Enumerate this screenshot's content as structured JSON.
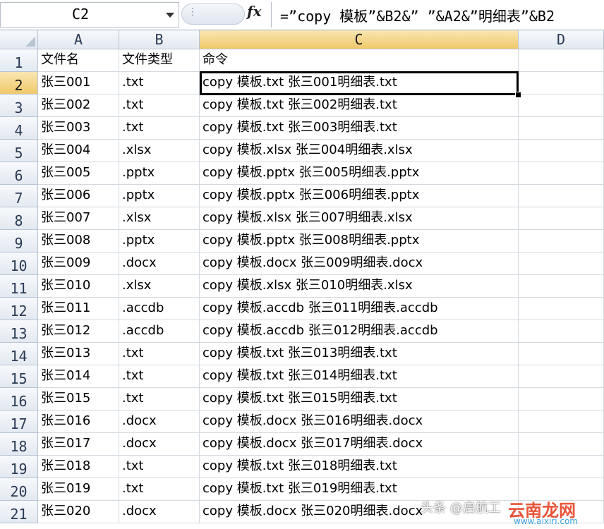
{
  "name_box": {
    "value": "C2"
  },
  "formula_bar": {
    "fx_label": "fx",
    "formula": "=”copy 模板”&B2&” ”&A2&”明细表”&B2"
  },
  "columns": [
    "A",
    "B",
    "C",
    "D"
  ],
  "selected_column": "C",
  "selected_row": 2,
  "rows": [
    {
      "num": "1",
      "a": "文件名",
      "b": "文件类型",
      "c": "命令"
    },
    {
      "num": "2",
      "a": "张三001",
      "b": ".txt",
      "c": "copy 模板.txt 张三001明细表.txt"
    },
    {
      "num": "3",
      "a": "张三002",
      "b": ".txt",
      "c": "copy 模板.txt 张三002明细表.txt"
    },
    {
      "num": "4",
      "a": "张三003",
      "b": ".txt",
      "c": "copy 模板.txt 张三003明细表.txt"
    },
    {
      "num": "5",
      "a": "张三004",
      "b": ".xlsx",
      "c": "copy 模板.xlsx 张三004明细表.xlsx"
    },
    {
      "num": "6",
      "a": "张三005",
      "b": ".pptx",
      "c": "copy 模板.pptx 张三005明细表.pptx"
    },
    {
      "num": "7",
      "a": "张三006",
      "b": ".pptx",
      "c": "copy 模板.pptx 张三006明细表.pptx"
    },
    {
      "num": "8",
      "a": "张三007",
      "b": ".xlsx",
      "c": "copy 模板.xlsx 张三007明细表.xlsx"
    },
    {
      "num": "9",
      "a": "张三008",
      "b": ".pptx",
      "c": "copy 模板.pptx 张三008明细表.pptx"
    },
    {
      "num": "10",
      "a": "张三009",
      "b": ".docx",
      "c": "copy 模板.docx 张三009明细表.docx"
    },
    {
      "num": "11",
      "a": "张三010",
      "b": ".xlsx",
      "c": "copy 模板.xlsx 张三010明细表.xlsx"
    },
    {
      "num": "12",
      "a": "张三011",
      "b": ".accdb",
      "c": "copy 模板.accdb 张三011明细表.accdb"
    },
    {
      "num": "13",
      "a": "张三012",
      "b": ".accdb",
      "c": "copy 模板.accdb 张三012明细表.accdb"
    },
    {
      "num": "14",
      "a": "张三013",
      "b": ".txt",
      "c": "copy 模板.txt 张三013明细表.txt"
    },
    {
      "num": "15",
      "a": "张三014",
      "b": ".txt",
      "c": "copy 模板.txt 张三014明细表.txt"
    },
    {
      "num": "16",
      "a": "张三015",
      "b": ".txt",
      "c": "copy 模板.txt 张三015明细表.txt"
    },
    {
      "num": "17",
      "a": "张三016",
      "b": ".docx",
      "c": "copy 模板.docx 张三016明细表.docx"
    },
    {
      "num": "18",
      "a": "张三017",
      "b": ".docx",
      "c": "copy 模板.docx 张三017明细表.docx"
    },
    {
      "num": "19",
      "a": "张三018",
      "b": ".txt",
      "c": "copy 模板.txt 张三018明细表.txt"
    },
    {
      "num": "20",
      "a": "张三019",
      "b": ".txt",
      "c": "copy 模板.txt 张三019明细表.txt"
    },
    {
      "num": "21",
      "a": "张三020",
      "b": ".docx",
      "c": "copy 模板.docx 张三020明细表.docx"
    }
  ],
  "watermark": {
    "text": "头条 @启航工",
    "logo": "云南龙网",
    "url": "www.aixiri.com"
  },
  "colors": {
    "header_bg": "#e3e9f1",
    "header_selected_bg": "#f0c96a",
    "gridline": "#d4d9e0",
    "active_border": "#000000"
  }
}
